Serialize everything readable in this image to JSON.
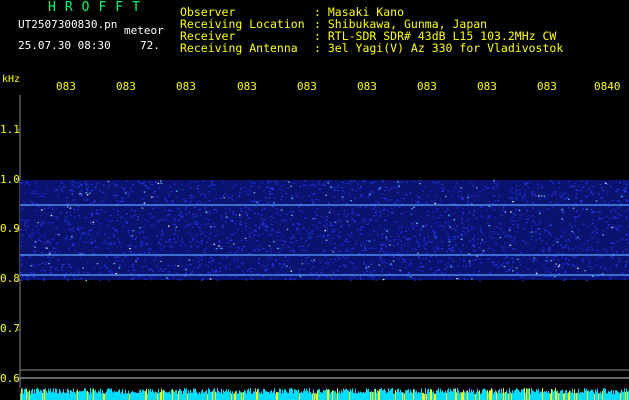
{
  "header": {
    "brand": "HROFFT",
    "filename": "UT2507300830.pn",
    "mode": "meteor",
    "datetime": "25.07.30 08:30",
    "count": "72.",
    "fields": [
      {
        "label": "Observer",
        "value": ": Masaki Kano"
      },
      {
        "label": "Receiving Location",
        "value": ": Shibukawa, Gunma, Japan"
      },
      {
        "label": "Receiver",
        "value": ": RTL-SDR SDR# 43dB L15 103.2MHz CW"
      },
      {
        "label": "Receiving Antenna",
        "value": ": 3el Yagi(V) Az 330 for Vladivostok"
      }
    ]
  },
  "spectrogram": {
    "freq_unit": "kHz",
    "freq_ticks": [
      "1.1",
      "1.0",
      "0.9",
      "0.8",
      "0.7",
      "0.6"
    ],
    "time_ticks": [
      "083",
      "083",
      "083",
      "083",
      "083",
      "083",
      "083",
      "083",
      "083",
      "0840"
    ],
    "band_low_khz": 0.8,
    "band_high_khz": 1.0,
    "carrier_lines_khz": [
      0.95,
      0.85,
      0.81
    ],
    "colors": {
      "background": "#000000",
      "signal": "#1a2bd8",
      "line": "#5599ff",
      "bottom_bar": "#00ddff",
      "grid": "#888888"
    }
  }
}
